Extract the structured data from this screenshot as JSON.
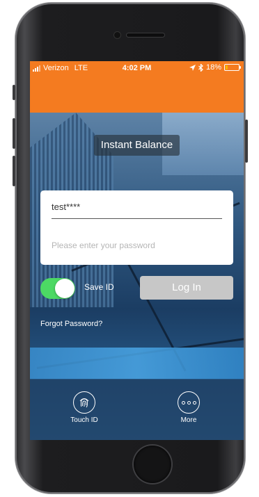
{
  "status_bar": {
    "carrier": "Verizon",
    "network": "LTE",
    "time": "4:02 PM",
    "battery_percent": "18%",
    "battery_level": 0.18,
    "battery_color": "#f7b500",
    "icons": [
      "signal-bars-icon",
      "location-arrow-icon",
      "bluetooth-icon",
      "battery-icon"
    ]
  },
  "header": {
    "color": "#f47b20"
  },
  "title": "Instant Balance",
  "login": {
    "id_value": "test****",
    "password_placeholder": "Please enter your password",
    "save_id_label": "Save ID",
    "save_id_enabled": true,
    "toggle_color": "#4cd964",
    "login_button": "Log In",
    "forgot_password": "Forgot Password?"
  },
  "tabs": [
    {
      "label": "Touch ID",
      "icon": "fingerprint-icon"
    },
    {
      "label": "More",
      "icon": "more-dots-icon"
    }
  ]
}
